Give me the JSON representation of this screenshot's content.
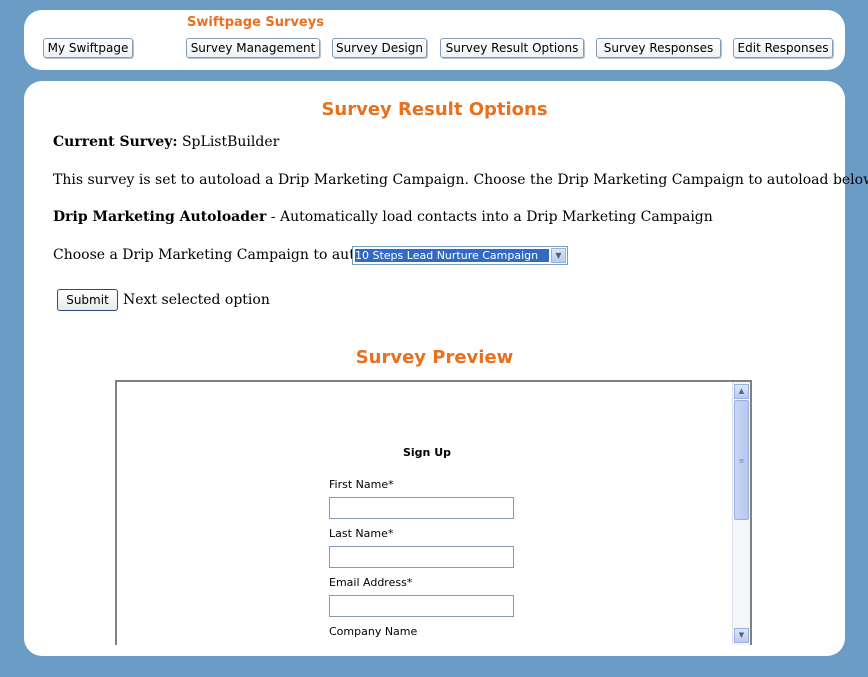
{
  "header": {
    "brand": "Swiftpage Surveys",
    "nav": [
      {
        "label": "My Swiftpage"
      },
      {
        "label": "Survey Management"
      },
      {
        "label": "Survey Design"
      },
      {
        "label": "Survey Result Options"
      },
      {
        "label": "Survey Responses"
      },
      {
        "label": "Edit Responses"
      }
    ]
  },
  "main": {
    "title": "Survey Result Options",
    "current_survey_label": "Current Survey:",
    "current_survey_value": "SpListBuilder",
    "autoload_notice": "This survey is set to autoload a Drip Marketing Campaign. Choose the Drip Marketing Campaign to autoload below.",
    "autoloader_label": "Drip Marketing Autoloader",
    "autoloader_desc": " - Automatically load contacts into a Drip Marketing Campaign",
    "choose_label": "Choose a Drip Marketing Campaign to autoload:",
    "campaign_selected": "10 Steps Lead Nurture Campaign",
    "submit_label": "Submit",
    "submit_note": "Next selected option"
  },
  "preview": {
    "title": "Survey Preview",
    "form_title": "Sign Up",
    "fields": [
      {
        "label": "First Name*",
        "value": ""
      },
      {
        "label": "Last Name*",
        "value": ""
      },
      {
        "label": "Email Address*",
        "value": ""
      },
      {
        "label": "Company Name",
        "value": ""
      }
    ]
  },
  "colors": {
    "background": "#6b9cc6",
    "accent": "#e8701f",
    "selection": "#316ac5"
  }
}
